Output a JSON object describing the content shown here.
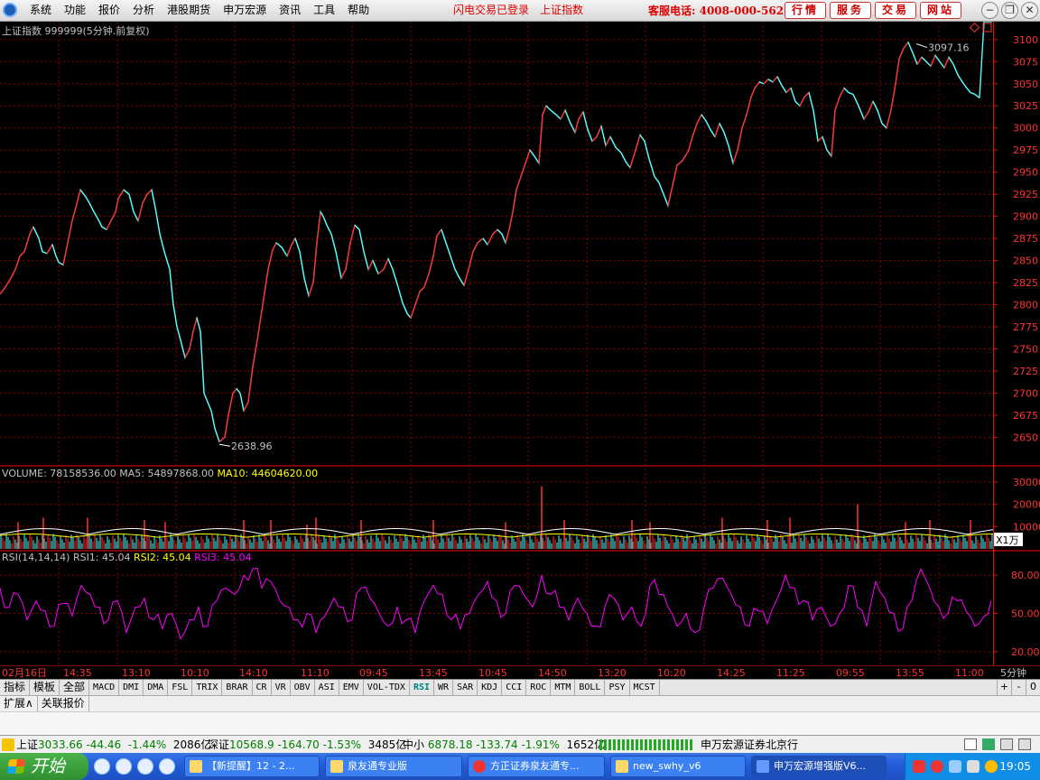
{
  "menubar": {
    "items": [
      "系统",
      "功能",
      "报价",
      "分析",
      "港股期货",
      "申万宏源",
      "资讯",
      "工具",
      "帮助"
    ],
    "status1": "闪电交易已登录",
    "status2": "上证指数",
    "hotline": "客服电话: 4008-000-562",
    "buttons": [
      "行情",
      "服务",
      "交易",
      "网站"
    ]
  },
  "price_panel": {
    "title": "上证指数",
    "code": "999999",
    "period": "(5分钟.前复权)",
    "high_label": "3097.16",
    "low_label": "2638.96"
  },
  "volume_panel": {
    "label": "VOLUME: 78158536.00",
    "ma5": "MA5: 54897868.00",
    "ma10": "MA10: 44604620.00",
    "unit": "X1万"
  },
  "rsi_panel": {
    "label": "RSI(14,14,14)",
    "rsi1": "RSI1: 45.04",
    "rsi2": "RSI2: 45.04",
    "rsi3": "RSI3: 45.04"
  },
  "time_axis": {
    "labels": [
      "02月16日",
      "14:35",
      "13:10",
      "10:10",
      "14:10",
      "11:10",
      "09:45",
      "13:45",
      "10:45",
      "14:50",
      "13:20",
      "10:20",
      "14:25",
      "11:25",
      "09:55",
      "13:55",
      "11:00"
    ],
    "period_label": "5分钟"
  },
  "indicator_tabs": [
    "指标",
    "模板",
    "全部",
    "MACD",
    "DMI",
    "DMA",
    "FSL",
    "TRIX",
    "BRAR",
    "CR",
    "VR",
    "OBV",
    "ASI",
    "EMV",
    "VOL-TDX",
    "RSI",
    "WR",
    "SAR",
    "KDJ",
    "CCI",
    "ROC",
    "MTM",
    "BOLL",
    "PSY",
    "MCST"
  ],
  "selected_tab": "RSI",
  "tab_controls": [
    "+",
    "-",
    "0"
  ],
  "bottom_tabs": [
    "扩展∧",
    "关联报价"
  ],
  "ticker": {
    "sh_name": "上证",
    "sh_price": "3033.66",
    "sh_change": "-44.46",
    "sh_pct": "-1.44%",
    "sh_amount": "2086亿",
    "sz_name": "深证",
    "sz_price": "10568.9",
    "sz_change": "-164.70",
    "sz_pct": "-1.53%",
    "sz_amount": "3485亿",
    "zx_name": "中小",
    "zx_price": "6878.18",
    "zx_change": "-133.74",
    "zx_pct": "-1.91%",
    "zx_amount": "1652亿",
    "broker": "申万宏源证券北京行"
  },
  "taskbar": {
    "start": "开始",
    "tasks": [
      "【新提醒】12 - 2...",
      "泉友通专业版",
      "方正证券泉友通专...",
      "new_swhy_v6",
      "申万宏源增强版V6..."
    ],
    "clock": "19:05"
  },
  "colors": {
    "up": "#ff3232",
    "down": "#54fcfc",
    "rsi": "#ff00ff",
    "ma5": "#ffffff",
    "ma10": "#ffff00",
    "grid": "#8b0000",
    "axis": "#ff0000"
  },
  "chart_data": [
    {
      "type": "line",
      "title": "上证指数 999999(5分钟.前复权)",
      "xlabel": "",
      "ylabel": "",
      "ylim": [
        2630,
        3110
      ],
      "yticks": [
        3100,
        3075,
        3050,
        3025,
        3000,
        2975,
        2950,
        2925,
        2900,
        2875,
        2850,
        2825,
        2800,
        2775,
        2750,
        2725,
        2700,
        2675,
        2650
      ],
      "x": [
        0,
        6,
        12,
        17,
        22,
        27,
        33,
        37,
        43,
        47,
        52,
        58,
        62,
        65,
        70,
        75,
        80,
        84,
        89,
        95,
        99,
        104,
        108,
        113,
        118,
        123,
        128,
        131,
        137,
        143,
        148,
        153,
        158,
        163,
        168,
        172,
        177,
        182,
        188,
        192,
        196,
        200,
        205,
        210,
        214,
        218,
        222,
        226,
        230,
        234,
        238,
        243,
        249,
        253,
        258,
        262,
        266,
        270,
        275,
        280,
        285,
        291,
        297,
        302,
        306,
        312,
        318,
        323,
        327,
        332,
        337,
        342,
        347,
        351,
        355,
        358,
        362,
        367,
        372,
        378,
        383,
        388,
        393,
        398,
        403,
        408,
        413,
        419,
        425,
        430,
        435,
        441,
        446,
        451,
        455,
        460,
        465,
        470,
        475,
        480,
        484,
        489,
        494,
        499,
        504,
        509,
        514,
        519,
        524,
        529,
        535,
        540,
        546,
        551,
        556,
        560,
        564,
        568,
        572,
        577,
        582,
        587,
        592,
        597,
        601,
        605,
        610,
        616,
        621,
        626,
        632,
        637,
        641,
        646,
        651,
        656,
        661,
        666,
        671,
        676,
        682,
        688,
        693,
        698,
        704,
        709,
        714,
        719,
        725,
        730,
        735,
        740,
        745,
        750,
        755,
        759,
        763,
        767,
        772,
        777,
        782,
        787,
        792,
        797,
        802,
        807,
        812,
        817,
        822,
        827,
        832,
        836,
        841,
        846,
        851,
        856,
        861,
        866,
        871,
        876,
        881,
        886,
        891,
        896,
        901,
        906,
        911,
        916,
        921,
        925,
        930,
        935,
        940,
        945,
        951,
        957,
        962,
        967,
        972,
        977,
        982,
        987,
        992,
        996,
        1001,
        1006,
        1011,
        1016,
        1021,
        1026,
        1031,
        1036,
        1041,
        1046,
        1051,
        1056,
        1061,
        1066,
        1071,
        1075,
        1080,
        1085,
        1090,
        1095,
        1099
      ],
      "values": [
        2812,
        2820,
        2830,
        2840,
        2855,
        2860,
        2880,
        2888,
        2875,
        2860,
        2858,
        2868,
        2855,
        2848,
        2845,
        2870,
        2895,
        2910,
        2930,
        2922,
        2915,
        2905,
        2898,
        2888,
        2885,
        2895,
        2905,
        2920,
        2930,
        2925,
        2905,
        2895,
        2915,
        2925,
        2930,
        2910,
        2880,
        2860,
        2840,
        2800,
        2775,
        2760,
        2740,
        2750,
        2770,
        2785,
        2770,
        2700,
        2690,
        2680,
        2660,
        2645,
        2650,
        2675,
        2700,
        2705,
        2700,
        2680,
        2690,
        2730,
        2760,
        2800,
        2840,
        2862,
        2870,
        2865,
        2855,
        2868,
        2875,
        2860,
        2830,
        2810,
        2825,
        2870,
        2905,
        2900,
        2890,
        2880,
        2860,
        2830,
        2840,
        2870,
        2890,
        2885,
        2860,
        2840,
        2850,
        2835,
        2840,
        2852,
        2840,
        2820,
        2802,
        2790,
        2785,
        2800,
        2815,
        2820,
        2835,
        2855,
        2878,
        2885,
        2870,
        2855,
        2840,
        2830,
        2822,
        2840,
        2860,
        2870,
        2875,
        2868,
        2880,
        2885,
        2880,
        2870,
        2885,
        2905,
        2930,
        2945,
        2960,
        2975,
        2968,
        2960,
        3015,
        3025,
        3020,
        3015,
        3010,
        3020,
        3005,
        2995,
        3010,
        3018,
        2998,
        2985,
        2990,
        3002,
        2980,
        2990,
        2978,
        2972,
        2962,
        2955,
        2975,
        2992,
        2985,
        2965,
        2945,
        2938,
        2925,
        2912,
        2935,
        2958,
        2962,
        2968,
        2975,
        2990,
        3005,
        3015,
        3008,
        2998,
        2990,
        3005,
        2995,
        2980,
        2960,
        2975,
        3000,
        3015,
        3035,
        3045,
        3052,
        3050,
        3055,
        3052,
        3058,
        3048,
        3040,
        3045,
        3030,
        3025,
        3035,
        3040,
        3020,
        2985,
        2990,
        2975,
        2968,
        3020,
        3035,
        3045,
        3040,
        3038,
        3025,
        3010,
        3018,
        3030,
        3020,
        3005,
        3000,
        3020,
        3050,
        3078,
        3090,
        3097,
        3085,
        3072,
        3080,
        3075,
        3070,
        3082,
        3075,
        3068,
        3080,
        3072,
        3060,
        3052,
        3045,
        3040,
        3038,
        3034
      ]
    },
    {
      "type": "bar",
      "title": "VOLUME",
      "ylim": [
        0,
        34000
      ],
      "yticks": [
        30000,
        20000,
        10000
      ],
      "unit": "X1万",
      "peaks": [
        {
          "x": 20,
          "value": 12000
        },
        {
          "x": 48,
          "value": 14000
        },
        {
          "x": 97,
          "value": 14000
        },
        {
          "x": 160,
          "value": 13000
        },
        {
          "x": 183,
          "value": 12000
        },
        {
          "x": 270,
          "value": 13000
        },
        {
          "x": 300,
          "value": 13000
        },
        {
          "x": 340,
          "value": 11000
        },
        {
          "x": 350,
          "value": 14000
        },
        {
          "x": 400,
          "value": 13000
        },
        {
          "x": 480,
          "value": 13000
        },
        {
          "x": 560,
          "value": 12000
        },
        {
          "x": 600,
          "value": 28000
        },
        {
          "x": 625,
          "value": 13000
        },
        {
          "x": 700,
          "value": 13000
        },
        {
          "x": 720,
          "value": 12000
        },
        {
          "x": 800,
          "value": 14000
        },
        {
          "x": 850,
          "value": 13000
        },
        {
          "x": 875,
          "value": 14000
        },
        {
          "x": 950,
          "value": 20000
        },
        {
          "x": 1003,
          "value": 12000
        },
        {
          "x": 1030,
          "value": 13000
        },
        {
          "x": 1075,
          "value": 13000
        }
      ]
    },
    {
      "type": "line",
      "title": "RSI(14,14,14)",
      "ylim": [
        10,
        95
      ],
      "yticks": [
        80,
        50,
        20
      ],
      "series": [
        {
          "name": "RSI1",
          "x": [
            0,
            10,
            20,
            30,
            40,
            50,
            60,
            70,
            80,
            90,
            100,
            110,
            120,
            130,
            140,
            150,
            160,
            170,
            180,
            190,
            200,
            210,
            220,
            230,
            240,
            250,
            260,
            270,
            280,
            290,
            300,
            310,
            320,
            330,
            340,
            350,
            360,
            370,
            380,
            390,
            400,
            410,
            420,
            430,
            440,
            450,
            460,
            470,
            480,
            490,
            500,
            510,
            520,
            530,
            540,
            550,
            560,
            570,
            580,
            590,
            600,
            610,
            620,
            630,
            640,
            650,
            660,
            670,
            680,
            690,
            700,
            710,
            720,
            730,
            740,
            750,
            760,
            770,
            780,
            790,
            800,
            810,
            820,
            830,
            840,
            850,
            860,
            870,
            880,
            890,
            900,
            910,
            920,
            930,
            940,
            950,
            960,
            970,
            980,
            990,
            1000,
            1010,
            1020,
            1030,
            1040,
            1050,
            1060,
            1070,
            1080,
            1090,
            1098
          ],
          "values": [
            70,
            55,
            65,
            45,
            60,
            52,
            40,
            58,
            48,
            72,
            65,
            55,
            45,
            60,
            35,
            55,
            62,
            45,
            38,
            50,
            30,
            45,
            55,
            40,
            60,
            70,
            65,
            80,
            85,
            70,
            75,
            60,
            55,
            45,
            50,
            35,
            48,
            62,
            55,
            45,
            70,
            62,
            50,
            40,
            55,
            45,
            35,
            60,
            72,
            65,
            45,
            38,
            50,
            65,
            75,
            60,
            50,
            72,
            65,
            55,
            80,
            65,
            55,
            45,
            62,
            50,
            40,
            55,
            62,
            45,
            55,
            40,
            72,
            65,
            55,
            40,
            50,
            35,
            55,
            70,
            78,
            65,
            55,
            40,
            52,
            42,
            60,
            80,
            70,
            60,
            45,
            55,
            40,
            50,
            72,
            55,
            40,
            75,
            62,
            50,
            38,
            60,
            85,
            70,
            55,
            50,
            60,
            52,
            40,
            48,
            60
          ]
        }
      ]
    }
  ]
}
